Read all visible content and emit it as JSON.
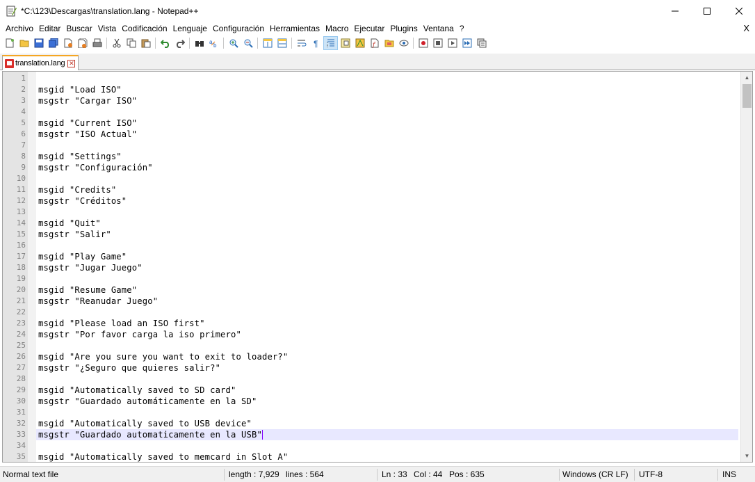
{
  "window": {
    "title": "*C:\\123\\Descargas\\translation.lang - Notepad++",
    "minimize": "—",
    "maximize": "☐",
    "close": "✕"
  },
  "menu": {
    "items": [
      "Archivo",
      "Editar",
      "Buscar",
      "Vista",
      "Codificación",
      "Lenguaje",
      "Configuración",
      "Herramientas",
      "Macro",
      "Ejecutar",
      "Plugins",
      "Ventana",
      "?"
    ],
    "close": "X"
  },
  "toolbar": {
    "icons": [
      "new-file-icon",
      "open-file-icon",
      "save-icon",
      "save-all-icon",
      "close-icon",
      "close-all-icon",
      "print-icon",
      "cut-icon",
      "copy-icon",
      "paste-icon",
      "undo-icon",
      "redo-icon",
      "find-icon",
      "replace-icon",
      "zoom-in-icon",
      "zoom-out-icon",
      "sync-vertical-icon",
      "sync-horizontal-icon",
      "word-wrap-icon",
      "show-all-chars-icon",
      "indent-guide-icon",
      "doc-map-icon",
      "function-list-icon",
      "folder-workspace-icon",
      "doc-list-icon",
      "monitor-icon",
      "record-macro-icon",
      "stop-record-icon",
      "play-macro-icon",
      "run-macro-multiple-icon",
      "save-macro-icon"
    ]
  },
  "tab": {
    "label": "translation.lang",
    "close": "✕"
  },
  "editor": {
    "current_line": 33,
    "lines": [
      {
        "n": "1",
        "text": ""
      },
      {
        "n": "2",
        "text": "msgid \"Load ISO\""
      },
      {
        "n": "3",
        "text": "msgstr \"Cargar ISO\""
      },
      {
        "n": "4",
        "text": ""
      },
      {
        "n": "5",
        "text": "msgid \"Current ISO\""
      },
      {
        "n": "6",
        "text": "msgstr \"ISO Actual\""
      },
      {
        "n": "7",
        "text": ""
      },
      {
        "n": "8",
        "text": "msgid \"Settings\""
      },
      {
        "n": "9",
        "text": "msgstr \"Configuración\""
      },
      {
        "n": "10",
        "text": ""
      },
      {
        "n": "11",
        "text": "msgid \"Credits\""
      },
      {
        "n": "12",
        "text": "msgstr \"Créditos\""
      },
      {
        "n": "13",
        "text": ""
      },
      {
        "n": "14",
        "text": "msgid \"Quit\""
      },
      {
        "n": "15",
        "text": "msgstr \"Salir\""
      },
      {
        "n": "16",
        "text": ""
      },
      {
        "n": "17",
        "text": "msgid \"Play Game\""
      },
      {
        "n": "18",
        "text": "msgstr \"Jugar Juego\""
      },
      {
        "n": "19",
        "text": ""
      },
      {
        "n": "20",
        "text": "msgid \"Resume Game\""
      },
      {
        "n": "21",
        "text": "msgstr \"Reanudar Juego\""
      },
      {
        "n": "22",
        "text": ""
      },
      {
        "n": "23",
        "text": "msgid \"Please load an ISO first\""
      },
      {
        "n": "24",
        "text": "msgstr \"Por favor carga la iso primero\""
      },
      {
        "n": "25",
        "text": ""
      },
      {
        "n": "26",
        "text": "msgid \"Are you sure you want to exit to loader?\""
      },
      {
        "n": "27",
        "text": "msgstr \"¿Seguro que quieres salir?\""
      },
      {
        "n": "28",
        "text": ""
      },
      {
        "n": "29",
        "text": "msgid \"Automatically saved to SD card\""
      },
      {
        "n": "30",
        "text": "msgstr \"Guardado automáticamente en la SD\""
      },
      {
        "n": "31",
        "text": ""
      },
      {
        "n": "32",
        "text": "msgid \"Automatically saved to USB device\""
      },
      {
        "n": "33",
        "text": "msgstr \"Guardado automaticamente en la USB\""
      },
      {
        "n": "34",
        "text": ""
      },
      {
        "n": "35",
        "text": "msgid \"Automatically saved to memcard in Slot A\""
      }
    ]
  },
  "status": {
    "file_type": "Normal text file",
    "length": "length : 7,929",
    "lines": "lines : 564",
    "ln": "Ln : 33",
    "col": "Col : 44",
    "pos": "Pos : 635",
    "eol": "Windows (CR LF)",
    "encoding": "UTF-8",
    "mode": "INS"
  },
  "colors": {
    "current_line_bg": "#e8e8ff",
    "caret": "#8000ff",
    "gutter_bg": "#e4e4e4",
    "tab_accent": "#f5a623"
  }
}
